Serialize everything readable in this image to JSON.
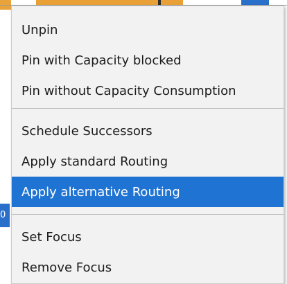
{
  "colors": {
    "menu_background": "#f2f2f2",
    "selected_background": "#1f73d2",
    "selected_text": "#ffffff",
    "text": "#1b1b1b",
    "separator": "#bdbdbd"
  },
  "context_menu": {
    "groups": [
      [
        {
          "label": "Unpin"
        },
        {
          "label": "Pin with Capacity blocked"
        },
        {
          "label": "Pin without Capacity Consumption"
        }
      ],
      [
        {
          "label": "Schedule Successors"
        },
        {
          "label": "Apply standard Routing"
        },
        {
          "label": "Apply alternative Routing",
          "selected": true
        }
      ],
      [
        {
          "label": "Set Focus"
        },
        {
          "label": "Remove Focus"
        }
      ]
    ]
  },
  "background": {
    "left_edge_text": "0"
  }
}
